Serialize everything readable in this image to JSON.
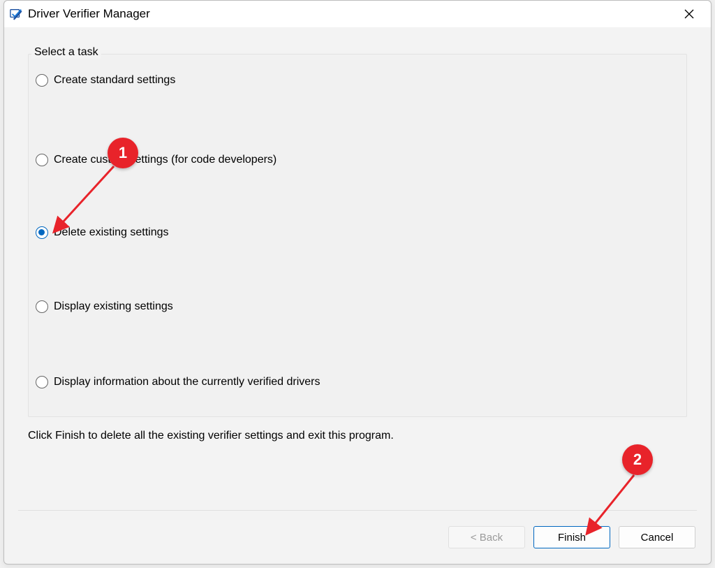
{
  "window": {
    "title": "Driver Verifier Manager"
  },
  "groupbox": {
    "legend": "Select a task"
  },
  "options": [
    {
      "label": "Create standard settings",
      "checked": false
    },
    {
      "label": "Create custom settings (for code developers)",
      "checked": false
    },
    {
      "label": "Delete existing settings",
      "checked": true
    },
    {
      "label": "Display existing settings",
      "checked": false
    },
    {
      "label": "Display information about the currently verified drivers",
      "checked": false
    }
  ],
  "instruction": "Click Finish to delete all the existing verifier settings and exit this program.",
  "buttons": {
    "back": "< Back",
    "finish": "Finish",
    "cancel": "Cancel"
  },
  "annotations": {
    "badge1": "1",
    "badge2": "2"
  }
}
